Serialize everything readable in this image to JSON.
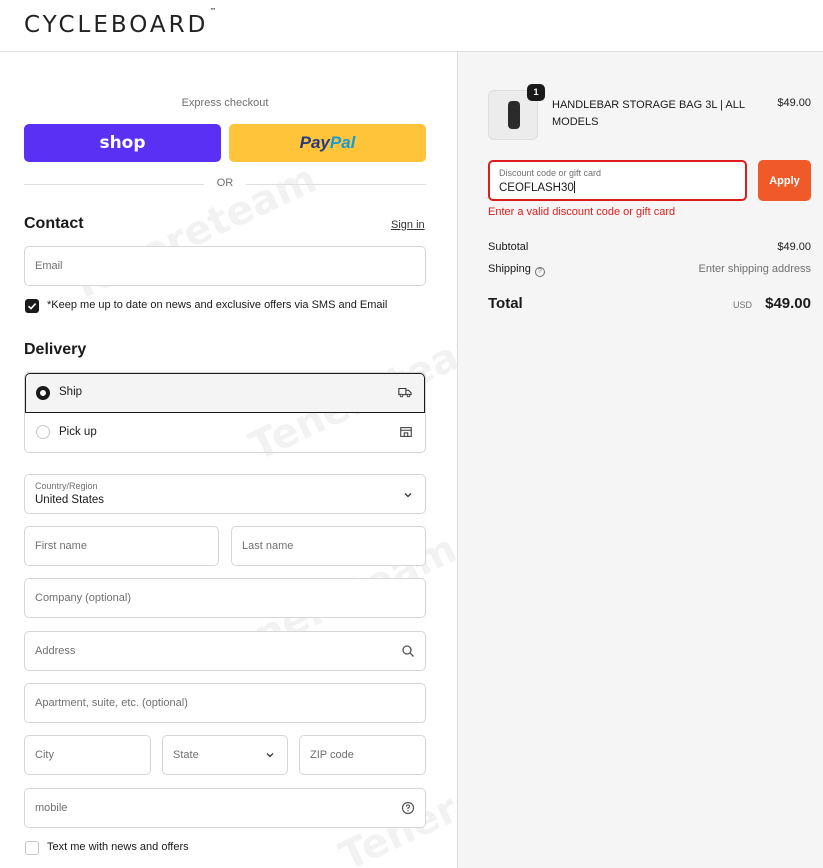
{
  "brand": {
    "logo": "CYCLEBOARD",
    "tm": "™"
  },
  "express": {
    "label": "Express checkout",
    "shop_label": "shop",
    "paypal_a": "Pay",
    "paypal_b": "Pal",
    "or_label": "OR"
  },
  "contact": {
    "heading": "Contact",
    "sign_in": "Sign in",
    "email_placeholder": "Email",
    "marketing_label": "*Keep me up to date on news and exclusive offers via SMS and Email",
    "marketing_checked": true
  },
  "delivery": {
    "heading": "Delivery",
    "options": [
      {
        "label": "Ship",
        "selected": true,
        "icon": "truck-icon"
      },
      {
        "label": "Pick up",
        "selected": false,
        "icon": "store-icon"
      }
    ],
    "country": {
      "label": "Country/Region",
      "value": "United States"
    },
    "first_name": "First name",
    "last_name": "Last name",
    "company": "Company (optional)",
    "address": "Address",
    "apartment": "Apartment, suite, etc. (optional)",
    "city": "City",
    "state": "State",
    "zip": "ZIP code",
    "phone": "mobile",
    "sms_label": "Text me with news and offers"
  },
  "order": {
    "item": {
      "name": "HANDLEBAR STORAGE BAG 3L | ALL MODELS",
      "price": "$49.00",
      "quantity": "1"
    },
    "discount": {
      "label": "Discount code or gift card",
      "value": "CEOFLASH30",
      "apply_label": "Apply",
      "error": "Enter a valid discount code or gift card"
    },
    "subtotal_label": "Subtotal",
    "subtotal_value": "$49.00",
    "shipping_label": "Shipping",
    "shipping_value": "Enter shipping address",
    "total_label": "Total",
    "total_currency": "USD",
    "total_value": "$49.00"
  },
  "colors": {
    "shop": "#5a31f4",
    "paypal": "#ffc439",
    "apply": "#f05a28",
    "error": "#dd1d1d"
  }
}
